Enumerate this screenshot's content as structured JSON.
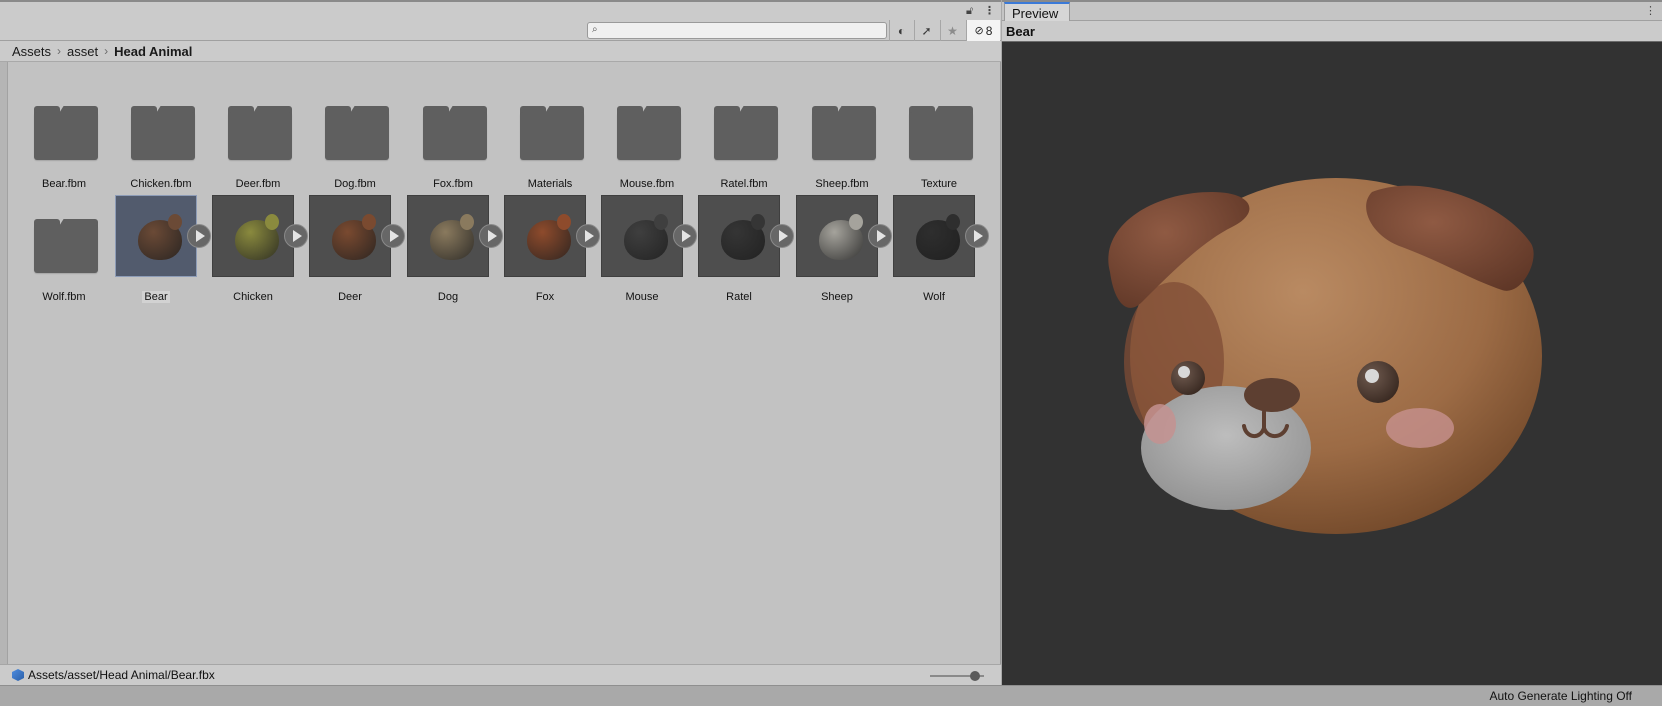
{
  "project": {
    "search": {
      "placeholder": "",
      "value": ""
    },
    "toolbar": {
      "filter_type_icon": "filter-type-icon",
      "label_icon": "label-icon",
      "favorite_icon": "star-icon",
      "hidden_packages_count": "8"
    },
    "breadcrumb": [
      "Assets",
      "asset",
      "Head Animal"
    ],
    "folders": [
      "Bear.fbm",
      "Chicken.fbm",
      "Deer.fbm",
      "Dog.fbm",
      "Fox.fbm",
      "Materials",
      "Mouse.fbm",
      "Ratel.fbm",
      "Sheep.fbm",
      "Texture",
      "Wolf.fbm"
    ],
    "models": [
      {
        "label": "Bear",
        "selected": true,
        "color": "#6b4a36"
      },
      {
        "label": "Chicken",
        "selected": false,
        "color": "#8a8a3e"
      },
      {
        "label": "Deer",
        "selected": false,
        "color": "#7a4a30"
      },
      {
        "label": "Dog",
        "selected": false,
        "color": "#8a7a5e"
      },
      {
        "label": "Fox",
        "selected": false,
        "color": "#8e4b2c"
      },
      {
        "label": "Mouse",
        "selected": false,
        "color": "#3f3f3f"
      },
      {
        "label": "Ratel",
        "selected": false,
        "color": "#353535"
      },
      {
        "label": "Sheep",
        "selected": false,
        "color": "#a5a39c"
      },
      {
        "label": "Wolf",
        "selected": false,
        "color": "#2e2e2e"
      }
    ],
    "status_path": "Assets/asset/Head Animal/Bear.fbx"
  },
  "preview": {
    "tab_label": "Preview",
    "asset_name": "Bear"
  },
  "status_bar": {
    "lighting": "Auto Generate Lighting Off"
  }
}
